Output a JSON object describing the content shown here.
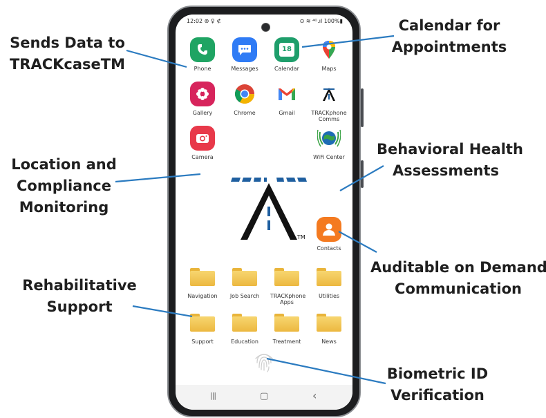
{
  "callouts": {
    "sends_data": [
      "Sends Data to",
      "TRACKcaseTM"
    ],
    "calendar": [
      "Calendar for",
      "Appointments"
    ],
    "behavioral": [
      "Behavioral Health",
      "Assessments"
    ],
    "location": [
      "Location and",
      "Compliance",
      "Monitoring"
    ],
    "auditable": [
      "Auditable on Demand",
      "Communication"
    ],
    "rehab": [
      "Rehabilitative",
      "Support"
    ],
    "biometric": [
      "Biometric ID",
      "Verification"
    ]
  },
  "status_bar": {
    "time": "12:02 ⊚ ♀ ⊄",
    "right": "⊙ ≋ ⁴ᴳ.ıl 100%▮"
  },
  "apps": {
    "phone": "Phone",
    "messages": "Messages",
    "calendar": "Calendar",
    "calendar_day": "18",
    "maps": "Maps",
    "gallery": "Gallery",
    "chrome": "Chrome",
    "gmail": "Gmail",
    "trackphone_comms": "TRACKphone Comms",
    "camera": "Camera",
    "wifi_center": "WiFi Center",
    "contacts": "Contacts"
  },
  "folders": {
    "navigation": "Navigation",
    "job_search": "Job Search",
    "trackphone_apps": "TRACKphone Apps",
    "utilities": "Utilities",
    "support": "Support",
    "education": "Education",
    "treatment": "Treatment",
    "news": "News"
  },
  "logo": {
    "tm": "TM"
  },
  "navbar": {
    "recents": "|||",
    "home": "▢",
    "back": "‹"
  },
  "colors": {
    "callout_line": "#2b7bc0",
    "phone_icon": "#1fa463",
    "messages_icon": "#2f7bf5",
    "calendar_icon": "#1e9e6b",
    "gallery_icon": "#d7245c",
    "camera_icon": "#e8394a",
    "contacts_icon": "#f47a20",
    "folder": "#f2c654"
  }
}
